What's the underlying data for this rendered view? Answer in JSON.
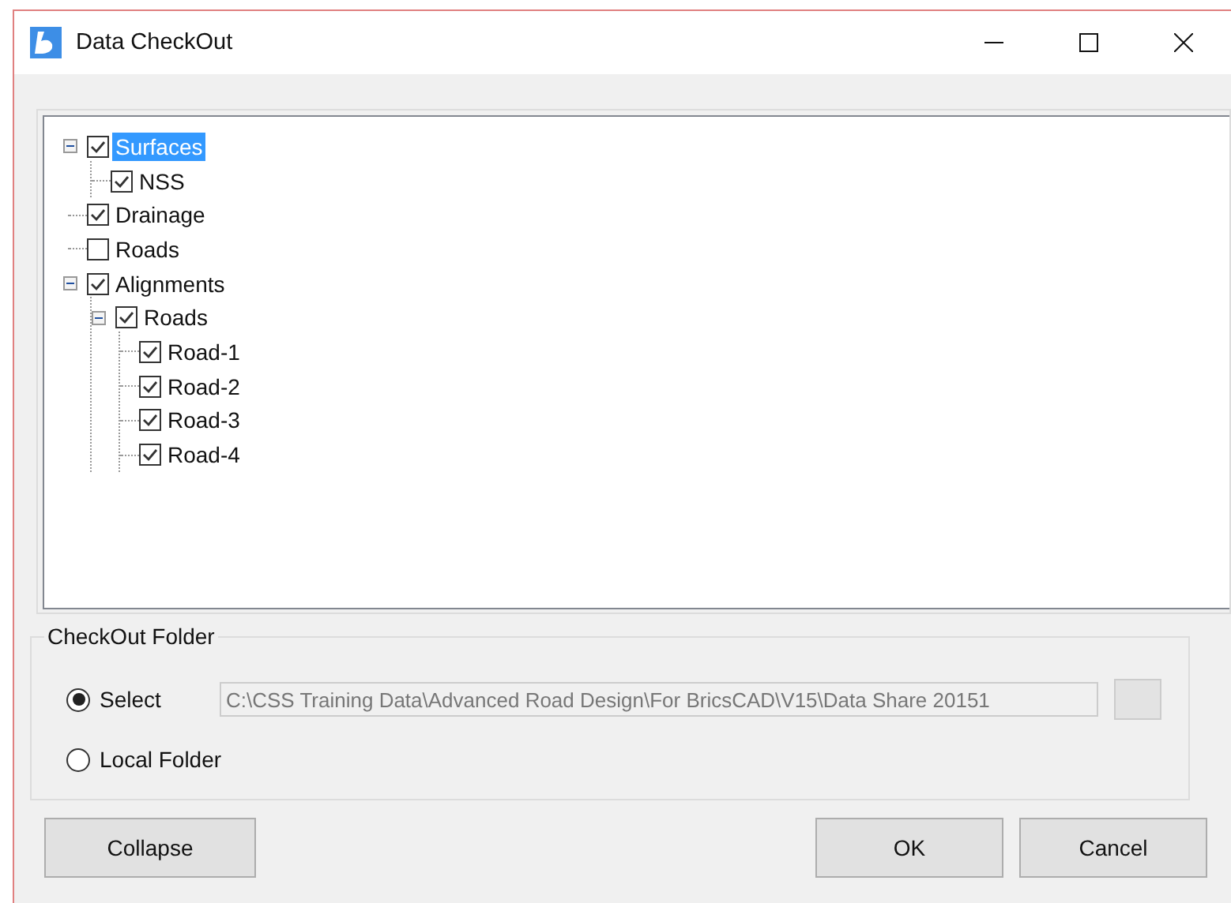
{
  "window": {
    "title": "Data CheckOut"
  },
  "tree": [
    {
      "label": "Surfaces",
      "checked": true,
      "selected": true,
      "expanded": true,
      "children": [
        {
          "label": "NSS",
          "checked": true,
          "selected": false
        }
      ]
    },
    {
      "label": "Drainage",
      "checked": true,
      "selected": false
    },
    {
      "label": "Roads",
      "checked": false,
      "selected": false
    },
    {
      "label": "Alignments",
      "checked": true,
      "selected": false,
      "expanded": true,
      "children": [
        {
          "label": "Roads",
          "checked": true,
          "selected": false,
          "expanded": true,
          "children": [
            {
              "label": "Road-1",
              "checked": true,
              "selected": false
            },
            {
              "label": "Road-2",
              "checked": true,
              "selected": false
            },
            {
              "label": "Road-3",
              "checked": true,
              "selected": false
            },
            {
              "label": "Road-4",
              "checked": true,
              "selected": false
            }
          ]
        }
      ]
    }
  ],
  "checkout_folder": {
    "title": "CheckOut Folder",
    "options": [
      {
        "label": "Select",
        "selected": true
      },
      {
        "label": "Local Folder",
        "selected": false
      }
    ],
    "path": "C:\\CSS Training Data\\Advanced Road Design\\For BricsCAD\\V15\\Data Share 20151"
  },
  "buttons": [
    {
      "label": "Collapse"
    },
    {
      "label": "OK"
    },
    {
      "label": "Cancel"
    }
  ]
}
